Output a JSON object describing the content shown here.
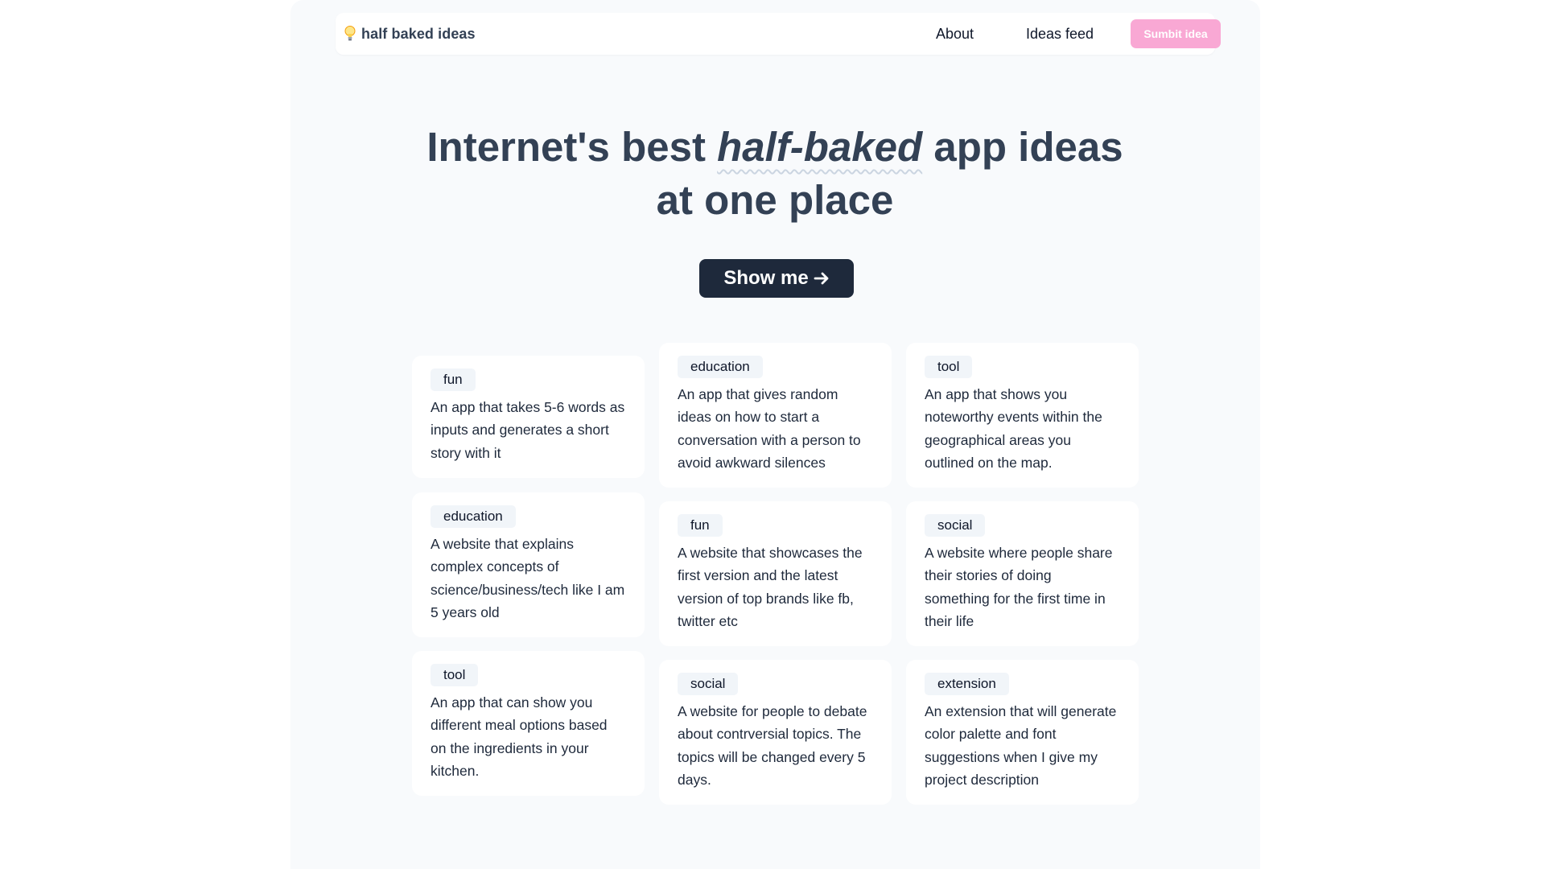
{
  "navbar": {
    "brand_icon": "lightbulb-icon",
    "brand_name": "half baked ideas",
    "links": [
      "About",
      "Ideas feed"
    ],
    "submit_label": "Sumbit idea"
  },
  "hero": {
    "title_before": "Internet's best ",
    "title_emphasis": "half-baked",
    "title_after": " app ideas at one place",
    "cta_label": "Show me",
    "cta_icon": "arrow-right-icon"
  },
  "ideas": [
    {
      "tag": "fun",
      "text": "An app that takes 5-6 words as inputs and generates a short story with it"
    },
    {
      "tag": "education",
      "text": "A website that explains complex concepts of science/business/tech like I am 5 years old"
    },
    {
      "tag": "tool",
      "text": "An app that can show you different meal options based on the ingredients in your kitchen."
    },
    {
      "tag": "education",
      "text": "An app that gives random ideas on how to start a conversation with a person to avoid awkward silences"
    },
    {
      "tag": "fun",
      "text": "A website that showcases the first version and the latest version of top brands like fb, twitter etc"
    },
    {
      "tag": "social",
      "text": "A website for people to debate about contrversial topics. The topics will be changed every 5 days."
    },
    {
      "tag": "tool",
      "text": "An app that shows you noteworthy events within the geographical areas you outlined on the map."
    },
    {
      "tag": "social",
      "text": "A website where people share their stories of doing something for the first time in their life"
    },
    {
      "tag": "extension",
      "text": "An extension that will generate color palette and font suggestions when I give my project description"
    }
  ],
  "colors": {
    "page_background": "#f8fafc",
    "heading": "#334155",
    "cta_background": "#1e293b",
    "submit_background": "#f9a8d4",
    "tag_background": "#f1f5f9"
  }
}
